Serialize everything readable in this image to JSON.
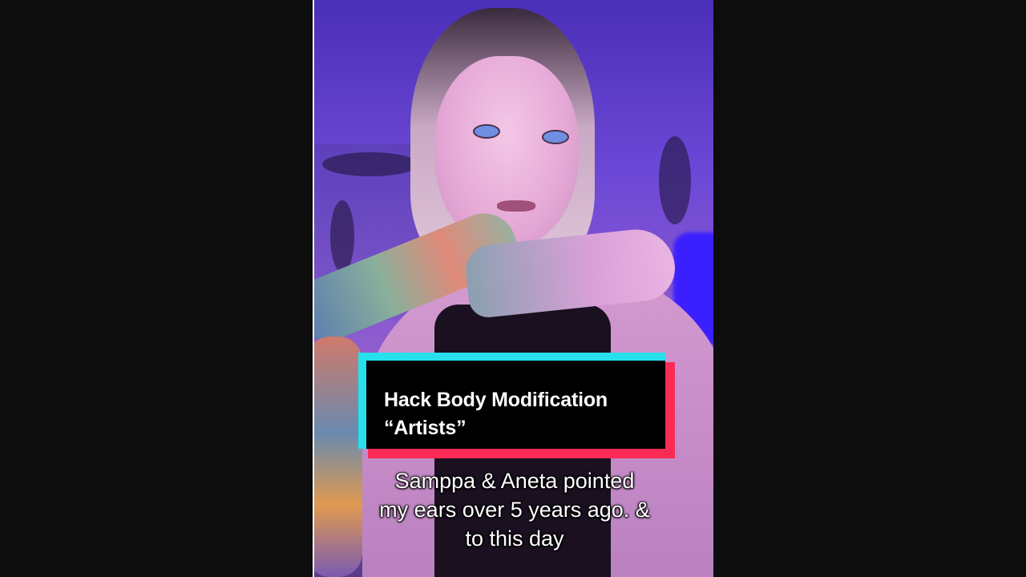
{
  "video": {
    "title_card": {
      "line1": "Hack Body Modification",
      "line2": "“Artists”"
    },
    "caption": {
      "line1": "Samppa & Aneta pointed",
      "line2": "my ears over 5 years ago. &",
      "line3": "to this day"
    }
  },
  "colors": {
    "letterbox": "#0d0d0d",
    "title_card_bg": "#000000",
    "title_accent_cyan": "#27e0ec",
    "title_accent_red": "#fb2b55",
    "text": "#ffffff"
  }
}
